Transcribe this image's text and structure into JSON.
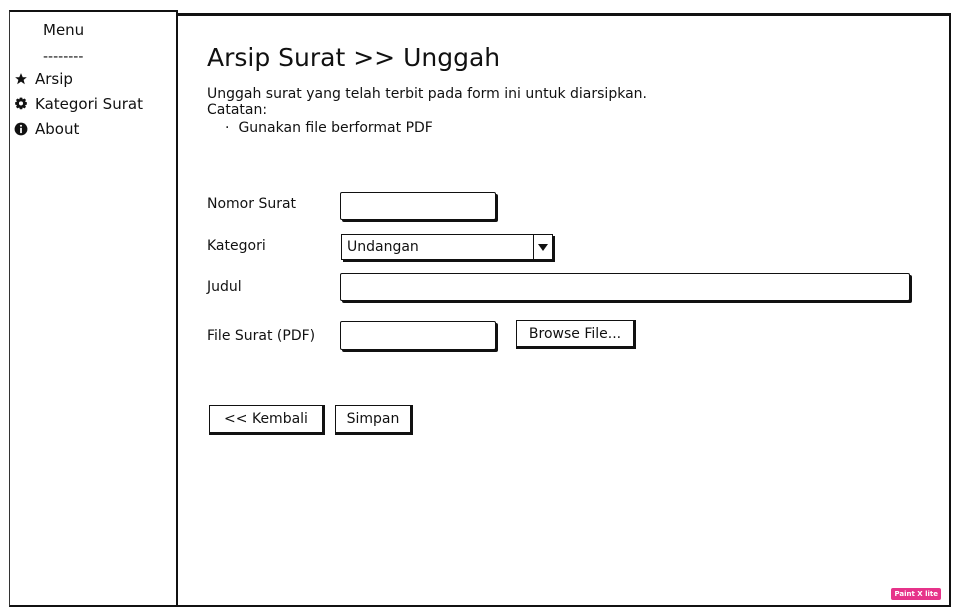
{
  "sidebar": {
    "menu_title": "Menu",
    "separator": "--------",
    "items": [
      {
        "label": "Arsip",
        "icon": "star-icon"
      },
      {
        "label": "Kategori Surat",
        "icon": "gear-icon"
      },
      {
        "label": "About",
        "icon": "info-icon"
      }
    ]
  },
  "page": {
    "title": "Arsip Surat >> Unggah",
    "description": "Unggah surat yang telah terbit pada form ini untuk diarsipkan.",
    "note_label": "Catatan:",
    "bullet_symbol": "·",
    "note_bullet": "Gunakan file berformat PDF"
  },
  "form": {
    "nomor_surat": {
      "label": "Nomor Surat",
      "value": ""
    },
    "kategori": {
      "label": "Kategori",
      "selected": "Undangan"
    },
    "judul": {
      "label": "Judul",
      "value": ""
    },
    "file_surat": {
      "label": "File Surat (PDF)",
      "value": "",
      "browse_label": "Browse File..."
    }
  },
  "buttons": {
    "back_label": "<< Kembali",
    "save_label": "Simpan"
  },
  "watermark": "Paint X lite",
  "colors": {
    "stroke": "#111111",
    "background": "#ffffff",
    "badge": "#e6338a"
  }
}
